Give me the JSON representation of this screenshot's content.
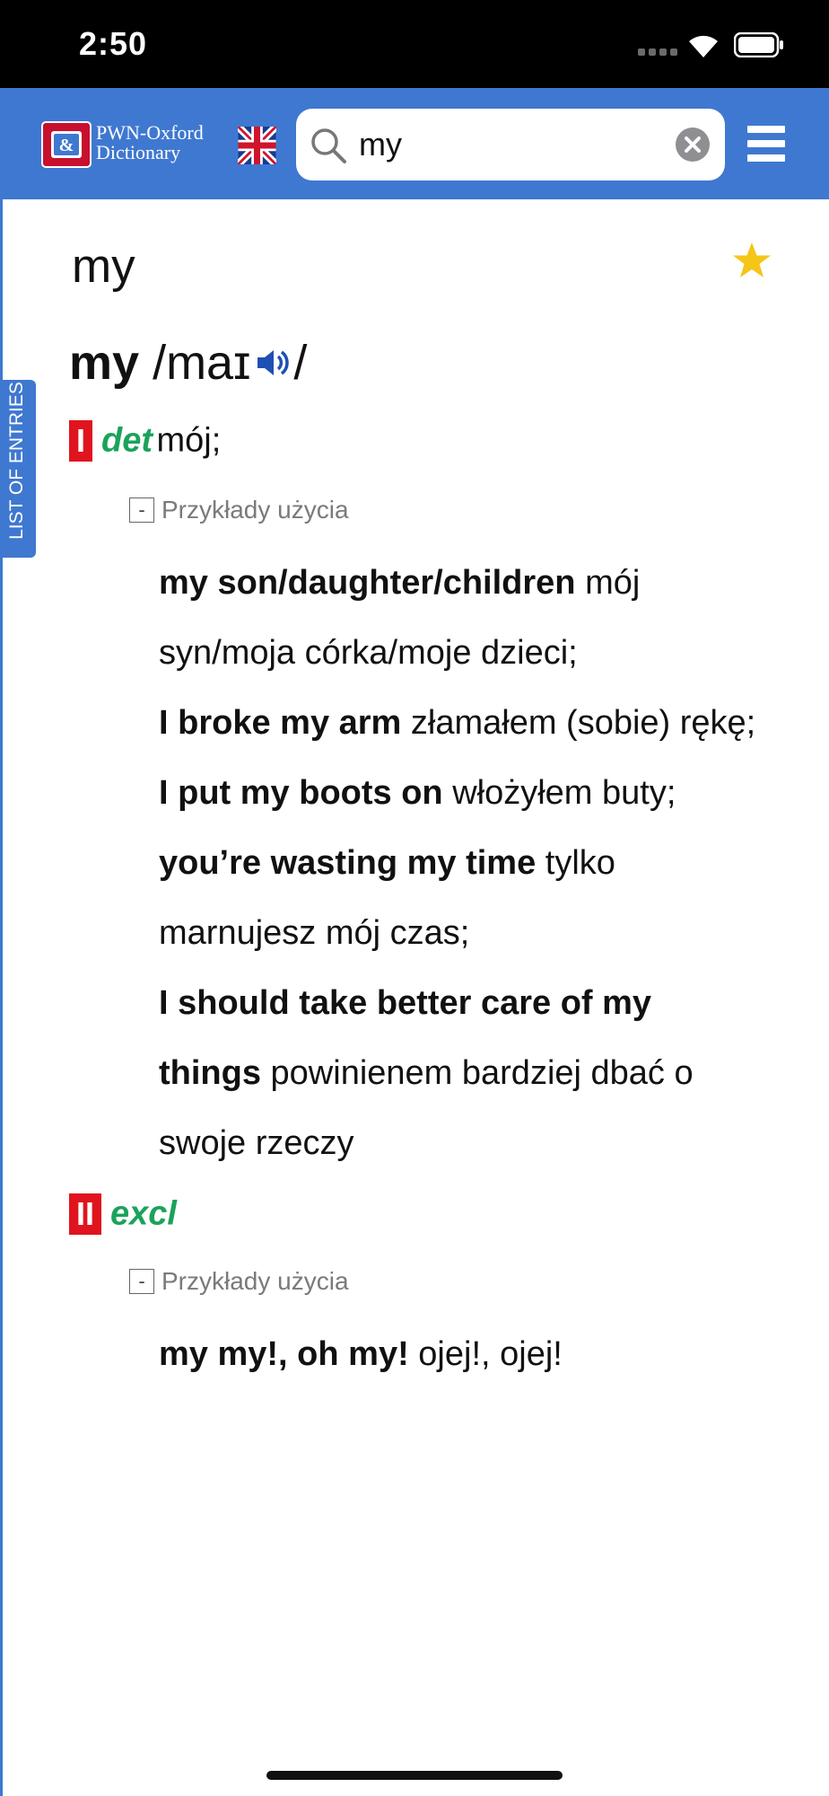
{
  "status": {
    "time": "2:50"
  },
  "app": {
    "name_line1": "PWN-Oxford",
    "name_line2": "Dictionary"
  },
  "search": {
    "value": "my",
    "placeholder": ""
  },
  "side_tab": {
    "label": "LIST OF ENTRIES"
  },
  "entry": {
    "title": "my",
    "headword": "my",
    "pron_before": "/maɪ",
    "pron_after": "/",
    "senses": [
      {
        "number": "I",
        "pos": "det",
        "translation": "mój;",
        "examples_label": "Przykłady użycia",
        "toggle_symbol": "-",
        "lines": [
          {
            "b": "my son/daughter/children",
            "t": " mój"
          },
          {
            "b": "",
            "t": "syn/moja córka/moje dzieci;"
          },
          {
            "b": "I broke my arm",
            "t": " złamałem (sobie) rękę;"
          },
          {
            "b": "I put my boots on",
            "t": " włożyłem buty;"
          },
          {
            "b": "you’re wasting my time",
            "t": " tylko"
          },
          {
            "b": "",
            "t": "marnujesz mój czas;"
          },
          {
            "b": "I should take better care of my",
            "t": ""
          },
          {
            "b": "things",
            "t": " powinienem bardziej dbać o"
          },
          {
            "b": "",
            "t": "swoje rzeczy"
          }
        ]
      },
      {
        "number": "II",
        "pos": "excl",
        "translation": "",
        "examples_label": "Przykłady użycia",
        "toggle_symbol": "-",
        "lines": [
          {
            "b": "my my!, oh my!",
            "t": " ojej!, ojej!"
          }
        ]
      }
    ]
  },
  "colors": {
    "header": "#3f78d0",
    "sense_badge": "#e0141e",
    "pos": "#1aa35a",
    "star": "#f5c518"
  },
  "icons": [
    "app-logo-icon",
    "uk-flag-icon",
    "search-icon",
    "clear-icon",
    "menu-icon",
    "star-icon",
    "speaker-icon",
    "wifi-icon",
    "battery-icon"
  ]
}
